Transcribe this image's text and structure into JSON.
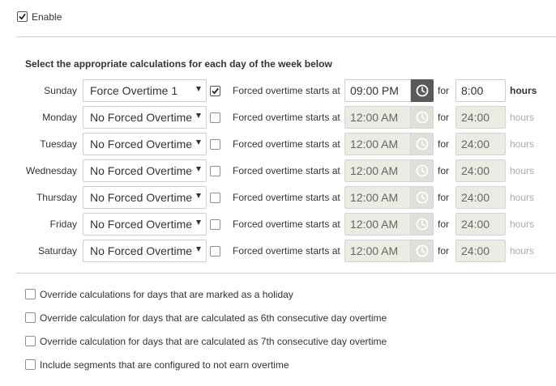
{
  "enable": {
    "label": "Enable",
    "checked": true
  },
  "section": {
    "heading": "Select the appropriate calculations for each day of the week below"
  },
  "rows": [
    {
      "day": "Sunday",
      "selection": "Force Overtime 1",
      "checked": true,
      "label": "Forced overtime starts at",
      "time": "09:00 PM",
      "for": "for",
      "hours_value": "8:00",
      "hours_label": "hours",
      "enabled": true
    },
    {
      "day": "Monday",
      "selection": "No Forced Overtime",
      "checked": false,
      "label": "Forced overtime starts at",
      "time": "12:00 AM",
      "for": "for",
      "hours_value": "24:00",
      "hours_label": "hours",
      "enabled": false
    },
    {
      "day": "Tuesday",
      "selection": "No Forced Overtime",
      "checked": false,
      "label": "Forced overtime starts at",
      "time": "12:00 AM",
      "for": "for",
      "hours_value": "24:00",
      "hours_label": "hours",
      "enabled": false
    },
    {
      "day": "Wednesday",
      "selection": "No Forced Overtime",
      "checked": false,
      "label": "Forced overtime starts at",
      "time": "12:00 AM",
      "for": "for",
      "hours_value": "24:00",
      "hours_label": "hours",
      "enabled": false
    },
    {
      "day": "Thursday",
      "selection": "No Forced Overtime",
      "checked": false,
      "label": "Forced overtime starts at",
      "time": "12:00 AM",
      "for": "for",
      "hours_value": "24:00",
      "hours_label": "hours",
      "enabled": false
    },
    {
      "day": "Friday",
      "selection": "No Forced Overtime",
      "checked": false,
      "label": "Forced overtime starts at",
      "time": "12:00 AM",
      "for": "for",
      "hours_value": "24:00",
      "hours_label": "hours",
      "enabled": false
    },
    {
      "day": "Saturday",
      "selection": "No Forced Overtime",
      "checked": false,
      "label": "Forced overtime starts at",
      "time": "12:00 AM",
      "for": "for",
      "hours_value": "24:00",
      "hours_label": "hours",
      "enabled": false
    }
  ],
  "options": [
    {
      "label": "Override calculations for days that are marked as a holiday",
      "checked": false
    },
    {
      "label": "Override calculation for days that are calculated as 6th consecutive day overtime",
      "checked": false
    },
    {
      "label": "Override calculation for days that are calculated as 7th consecutive day overtime",
      "checked": false
    },
    {
      "label": "Include segments that are configured to not earn overtime",
      "checked": false
    }
  ],
  "icons": {
    "checkbox_tick": "check-icon",
    "time_picker": "clock-icon",
    "dropdown": "caret-down-icon"
  }
}
